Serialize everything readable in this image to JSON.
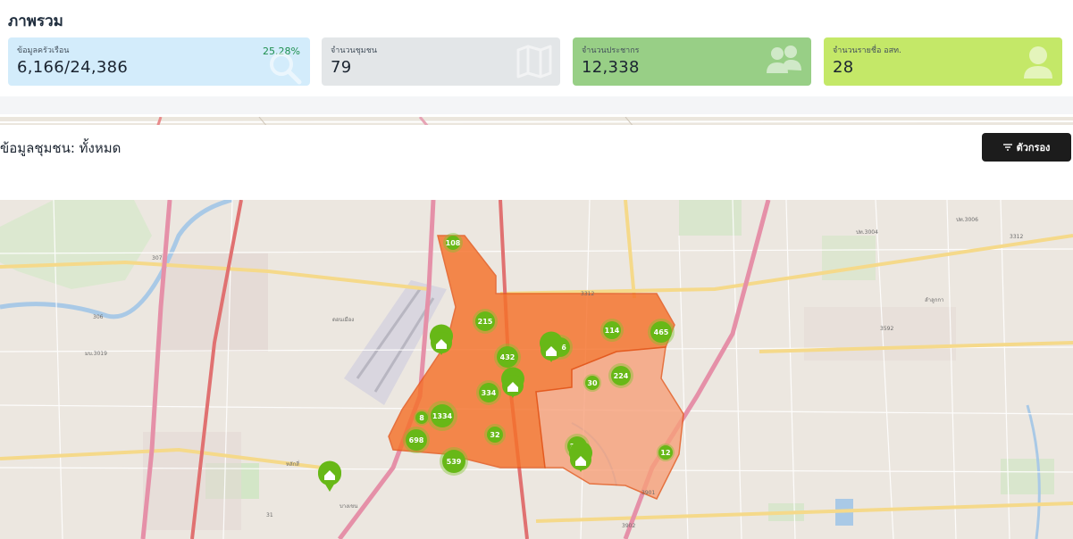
{
  "overview": {
    "title": "ภาพรวม"
  },
  "cards": [
    {
      "label": "ข้อมูลครัวเรือน",
      "value": "6,166/24,386",
      "percent": "25.28%",
      "color": "#d3ecfb",
      "icon": "search-icon"
    },
    {
      "label": "จำนวนชุมชน",
      "value": "79",
      "color": "#e3e6e8",
      "icon": "map-icon"
    },
    {
      "label": "จำนวนประชากร",
      "value": "12,338",
      "color": "#98cf86",
      "icon": "people-icon"
    },
    {
      "label": "จำนวนรายชื่อ อสท.",
      "value": "28",
      "color": "#c4e868",
      "icon": "person-icon"
    }
  ],
  "section": {
    "title": "ข้อมูลชุมชน: ทั้งหมด"
  },
  "filter": {
    "label": "ตัวกรอง",
    "icon": "filter-icon"
  },
  "map": {
    "clusters": [
      "108",
      "215",
      "114",
      "465",
      "432",
      "6",
      "334",
      "30",
      "224",
      "1334",
      "8",
      "698",
      "32",
      "539",
      "371",
      "12"
    ],
    "labels": [
      "ดอนเมือง",
      "ลำลูกกา",
      "หลักสี่",
      "บางเขน",
      "ปท.3004",
      "ปท.3006",
      "3312",
      "3312",
      "307",
      "306",
      "3592",
      "3901",
      "3902",
      "31",
      "มบ.3019"
    ]
  }
}
